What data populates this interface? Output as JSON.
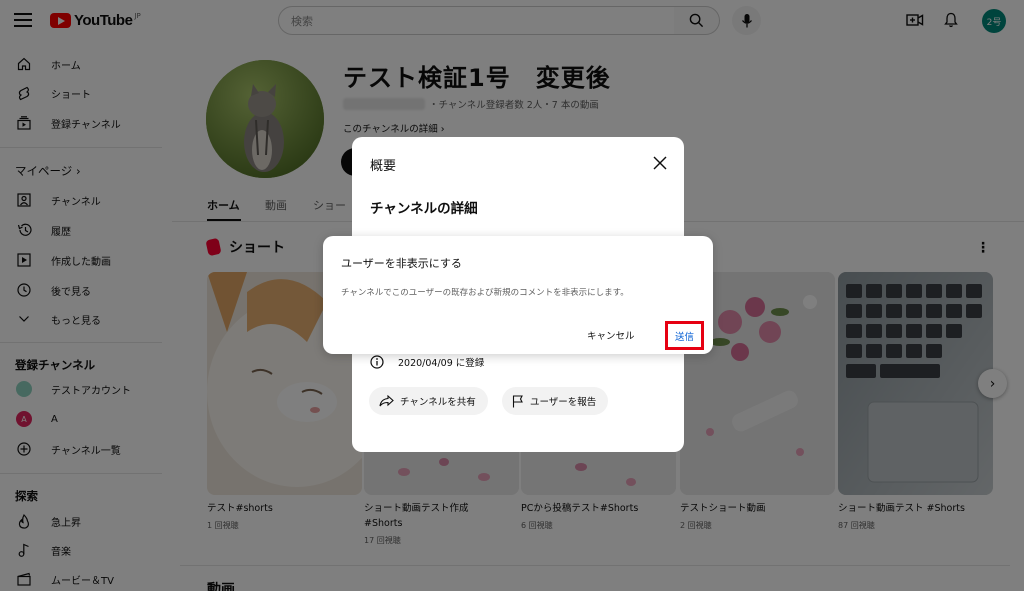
{
  "header": {
    "logo_text": "YouTube",
    "region": "JP",
    "search_placeholder": "検索",
    "avatar_label": "2号"
  },
  "sidebar": {
    "top_items": [
      {
        "label": "ホーム",
        "icon": "home-icon"
      },
      {
        "label": "ショート",
        "icon": "shorts-icon"
      },
      {
        "label": "登録チャンネル",
        "icon": "subscriptions-icon"
      }
    ],
    "mypage_heading": "マイページ",
    "mypage_items": [
      {
        "label": "チャンネル",
        "icon": "channel-icon"
      },
      {
        "label": "履歴",
        "icon": "history-icon"
      },
      {
        "label": "作成した動画",
        "icon": "your-videos-icon"
      },
      {
        "label": "後で見る",
        "icon": "watch-later-icon"
      },
      {
        "label": "もっと見る",
        "icon": "chevron-down-icon"
      }
    ],
    "subs_heading": "登録チャンネル",
    "subs_items": [
      {
        "label": "テストアカウント",
        "color": "#8fd3c0"
      },
      {
        "label": "A",
        "color": "#e0245e",
        "initial": "A"
      },
      {
        "label": "チャンネル一覧",
        "icon": "add-circle-icon"
      }
    ],
    "explore_heading": "探索",
    "explore_items": [
      {
        "label": "急上昇",
        "icon": "trending-icon"
      },
      {
        "label": "音楽",
        "icon": "music-icon"
      },
      {
        "label": "ムービー＆TV",
        "icon": "movie-icon"
      }
    ]
  },
  "channel": {
    "title": "テスト検証1号　変更後",
    "meta": "・チャンネル登録者数 2人・7 本の動画",
    "details_link": "このチャンネルの詳細 ",
    "tabs": [
      "ホーム",
      "動画",
      "ショー"
    ]
  },
  "shorts": {
    "heading": "ショート",
    "items": [
      {
        "title": "テスト#shorts",
        "views": "1 回視聴"
      },
      {
        "title": "ショート動画テスト作成 #Shorts",
        "views": "17 回視聴"
      },
      {
        "title": "PCから投稿テスト#Shorts",
        "views": "6 回視聴"
      },
      {
        "title": "テストショート動画",
        "views": "2 回視聴"
      },
      {
        "title": "ショート動画テスト #Shorts",
        "views": "87 回視聴"
      }
    ]
  },
  "videos_heading": "動画",
  "about_dialog": {
    "title": "概要",
    "subtitle": "チャンネルの詳細",
    "joined": "2020/04/09 に登録",
    "share_label": "チャンネルを共有",
    "report_label": "ユーザーを報告"
  },
  "confirm_dialog": {
    "title": "ユーザーを非表示にする",
    "message": "チャンネルでこのユーザーの既存および新規のコメントを非表示にします。",
    "cancel_label": "キャンセル",
    "submit_label": "送信"
  }
}
